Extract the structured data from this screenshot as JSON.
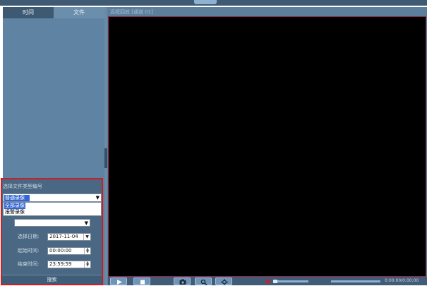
{
  "tabs": {
    "time": "时间",
    "file": "文件"
  },
  "search": {
    "title": "选择文件类型编号",
    "type_selected": "普通录像",
    "type_options": [
      "全部录像",
      "报警录像"
    ],
    "channel_value": "",
    "date_label": "选择日期:",
    "date_value": "2017-11-04",
    "start_label": "起始时间:",
    "start_value": "00:00:00",
    "end_label": "结束时间:",
    "end_value": "23:59:59",
    "button_label": "搜索"
  },
  "video": {
    "title": "远程回放 [通道 01]"
  },
  "controls": {
    "time_readout": "0:00:00/0:00:00"
  },
  "icons": {
    "play": "play-icon",
    "stop": "stop-icon",
    "snapshot": "camera-icon",
    "zoom": "zoom-icon",
    "ptz": "ptz-icon",
    "volume": "speaker-icon"
  },
  "colors": {
    "selection": "#3367d6",
    "highlight_border": "#d11c24",
    "panel": "#5c7f9d"
  }
}
